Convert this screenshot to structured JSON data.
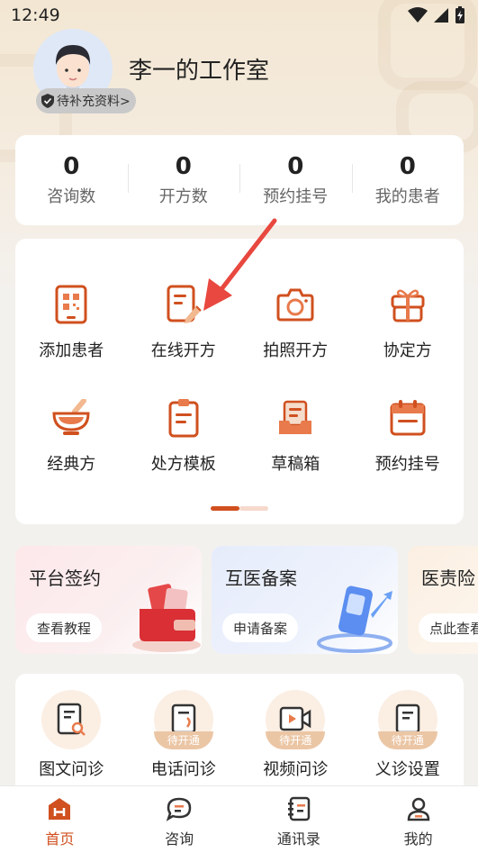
{
  "status_bar": {
    "time": "12:49"
  },
  "profile": {
    "studio_name": "李一的工作室",
    "badge_text": "待补充资料>"
  },
  "stats": [
    {
      "value": "0",
      "label": "咨询数"
    },
    {
      "value": "0",
      "label": "开方数"
    },
    {
      "value": "0",
      "label": "预约挂号"
    },
    {
      "value": "0",
      "label": "我的患者"
    }
  ],
  "tools": [
    {
      "label": "添加患者",
      "icon": "qr-tablet-icon"
    },
    {
      "label": "在线开方",
      "icon": "prescription-pen-icon"
    },
    {
      "label": "拍照开方",
      "icon": "camera-icon"
    },
    {
      "label": "协定方",
      "icon": "gift-box-icon"
    },
    {
      "label": "经典方",
      "icon": "mortar-bowl-icon"
    },
    {
      "label": "处方模板",
      "icon": "clipboard-icon"
    },
    {
      "label": "草稿箱",
      "icon": "drafts-tray-icon"
    },
    {
      "label": "预约挂号",
      "icon": "calendar-icon"
    }
  ],
  "pager": {
    "pages": 2,
    "current": 1
  },
  "promos": [
    {
      "title": "平台签约",
      "button": "查看教程"
    },
    {
      "title": "互医备案",
      "button": "申请备案"
    },
    {
      "title": "医责险",
      "button": "点此查看"
    }
  ],
  "consult": [
    {
      "label": "图文问诊",
      "tag": ""
    },
    {
      "label": "电话问诊",
      "tag": "待开通"
    },
    {
      "label": "视频问诊",
      "tag": "待开通"
    },
    {
      "label": "义诊设置",
      "tag": "待开通"
    }
  ],
  "nav": [
    {
      "label": "首页",
      "active": true
    },
    {
      "label": "咨询",
      "active": false
    },
    {
      "label": "通讯录",
      "active": false
    },
    {
      "label": "我的",
      "active": false
    }
  ],
  "colors": {
    "accent": "#d0501f",
    "accent_light": "#e87a4b",
    "tag": "#ebc6a5",
    "annotation": "#e8483f"
  }
}
